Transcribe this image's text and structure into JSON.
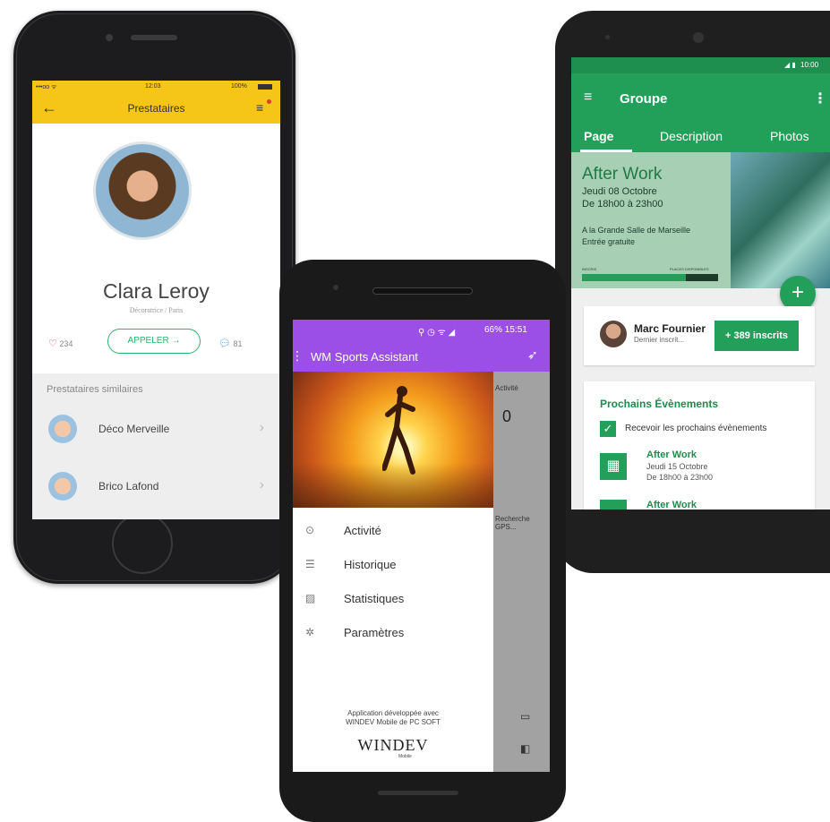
{
  "phone1": {
    "status_time": "12:03",
    "status_carrier": "•••oo ᯤ",
    "status_battery": "100%",
    "nav_title": "Prestataires",
    "profile_name": "Clara Leroy",
    "profile_subtitle": "Décoratrice / Paris",
    "likes_count": "234",
    "call_button": "APPELER →",
    "messages_count": "81",
    "similar_title": "Prestataires similaires",
    "similar": [
      {
        "label": "Déco Merveille"
      },
      {
        "label": "Brico Lafond"
      }
    ]
  },
  "phone2": {
    "status_text": "66% 15:51",
    "app_title": "WM Sports Assistant",
    "behind_header": "Activité",
    "behind_zero": "0",
    "behind_gps": "Recherche GPS...",
    "menu": [
      {
        "icon": "target-icon",
        "label": "Activité"
      },
      {
        "icon": "list-icon",
        "label": "Historique"
      },
      {
        "icon": "chart-icon",
        "label": "Statistiques"
      },
      {
        "icon": "gear-icon",
        "label": "Paramètres"
      }
    ],
    "credit_line1": "Application développée avec",
    "credit_line2": "WINDEV Mobile de PC SOFT",
    "brand": "WINDEV",
    "brand_sub": "Mobile"
  },
  "phone3": {
    "status_time": "10:00",
    "toolbar_title": "Groupe",
    "tabs": [
      {
        "label": "Page",
        "active": true
      },
      {
        "label": "Description",
        "active": false
      },
      {
        "label": "Photos",
        "active": false
      }
    ],
    "event_title": "After Work",
    "event_date": "Jeudi 08 Octobre",
    "event_time": "De 18h00 à 23h00",
    "event_place": "A la Grande Salle de Marseille",
    "event_price": "Entrée gratuite",
    "bar_left_label": "INSCRIS",
    "bar_right_label": "PLACES DISPONIBLES",
    "bar_fill_fraction": 0.76,
    "member_name": "Marc Fournier",
    "member_sub": "Dernier inscrit...",
    "inscrits_button": "+ 389 inscrits",
    "upcoming_title": "Prochains Évènements",
    "checkbox_label": "Recevoir les prochains évènements",
    "upcoming": [
      {
        "title": "After Work",
        "date": "Jeudi 15 Octobre",
        "time": "De 18h00 à 23h00"
      },
      {
        "title": "After Work",
        "date": "",
        "time": ""
      }
    ]
  },
  "colors": {
    "yellow": "#f5c518",
    "green": "#22a05a",
    "purple": "#9b4fe6"
  }
}
